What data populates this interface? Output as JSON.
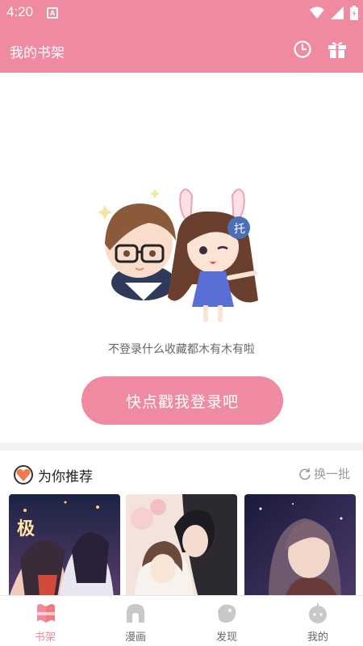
{
  "status_bar": {
    "time": "4:20",
    "notif_letter": "A"
  },
  "app_bar": {
    "title": "我的书架",
    "history_icon": "clock-icon",
    "gift_icon": "gift-box-icon"
  },
  "empty_state": {
    "message": "不登录什么收藏都木有木有啦",
    "login_button": "快点戳我登录吧"
  },
  "recommend": {
    "title": "为你推荐",
    "refresh_label": "换一批"
  },
  "covers": [
    {
      "name": "cover-1"
    },
    {
      "name": "cover-2"
    },
    {
      "name": "cover-3"
    }
  ],
  "bottom_nav": {
    "items": [
      {
        "label": "书架",
        "icon": "bookshelf-icon",
        "active": true
      },
      {
        "label": "漫画",
        "icon": "comic-icon",
        "active": false
      },
      {
        "label": "发现",
        "icon": "discover-icon",
        "active": false
      },
      {
        "label": "我的",
        "icon": "profile-icon",
        "active": false
      }
    ]
  },
  "colors": {
    "primary": "#ef8aa0",
    "text_muted": "#666666",
    "divider": "#f3f3f3"
  }
}
